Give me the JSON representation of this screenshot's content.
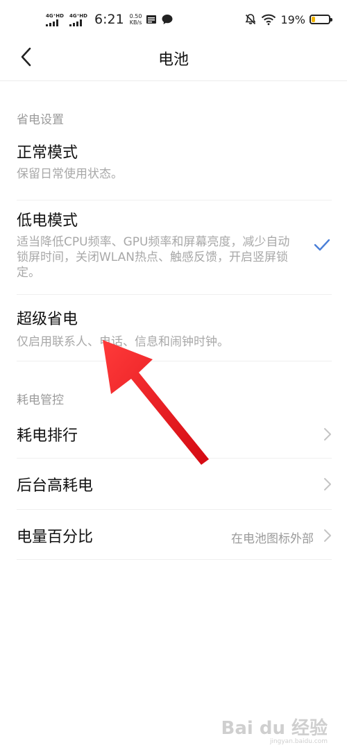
{
  "status_bar": {
    "net1_label": "4G⁺HD",
    "net2_label": "4G⁺HD",
    "time": "6:21",
    "speed_value": "0.50",
    "speed_unit": "KB/s",
    "battery_percent": "19%",
    "battery_level": 0.19,
    "battery_color": "#f1b500"
  },
  "header": {
    "title": "电池"
  },
  "sections": {
    "power_saving": "省电设置",
    "power_control": "耗电管控"
  },
  "modes": {
    "normal": {
      "title": "正常模式",
      "desc": "保留日常使用状态。"
    },
    "low_power": {
      "title": "低电模式",
      "desc": "适当降低CPU频率、GPU频率和屏幕亮度，减少自动锁屏时间，关闭WLAN热点、触感反馈，开启竖屏锁定。",
      "selected": true
    },
    "super_saver": {
      "title": "超级省电",
      "desc": "仅启用联系人、电话、信息和闹钟时钟。"
    }
  },
  "control": {
    "ranking": {
      "title": "耗电排行"
    },
    "background": {
      "title": "后台高耗电"
    },
    "percentage": {
      "title": "电量百分比",
      "value": "在电池图标外部"
    }
  },
  "colors": {
    "accent_check": "#4a7fd8",
    "annotation_arrow": "#e8141c"
  },
  "watermark": {
    "logo": "Bai du 经验",
    "url": "jingyan.baidu.com"
  }
}
